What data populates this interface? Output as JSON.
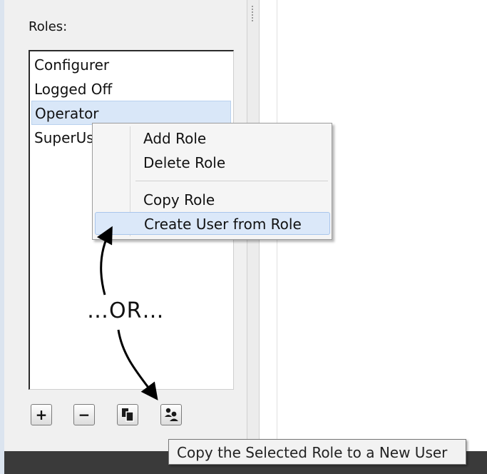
{
  "roles_panel": {
    "label": "Roles:",
    "items": [
      {
        "label": "Configurer"
      },
      {
        "label": "Logged Off"
      },
      {
        "label": "Operator",
        "selected": true
      },
      {
        "label": "SuperUs"
      }
    ]
  },
  "context_menu": {
    "items": [
      "Add Role",
      "Delete Role",
      "Copy Role",
      "Create User from Role"
    ],
    "highlighted": "Create User from Role"
  },
  "annotation": {
    "or_text": "…OR…"
  },
  "toolbar": {
    "buttons": [
      {
        "name": "add",
        "glyph": "+"
      },
      {
        "name": "remove",
        "glyph": "−"
      },
      {
        "name": "copy",
        "icon": "copy-icon"
      },
      {
        "name": "create-user",
        "icon": "users-icon"
      }
    ]
  },
  "tooltip": {
    "text": "Copy the Selected Role to a New User"
  }
}
